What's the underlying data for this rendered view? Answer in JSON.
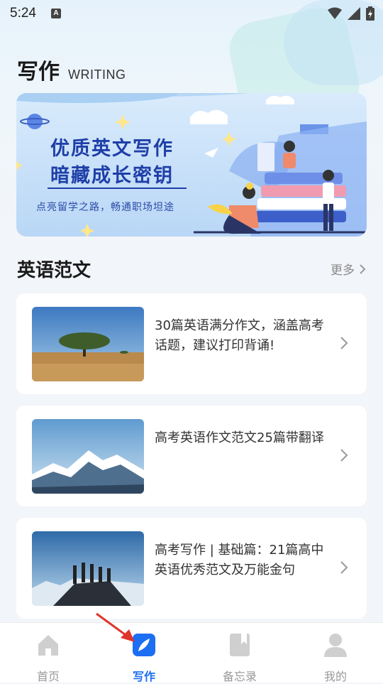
{
  "status_bar": {
    "time": "5:24",
    "notification_icon_label": "A",
    "icons": [
      "wifi-icon",
      "signal-icon",
      "battery-icon"
    ]
  },
  "header": {
    "title": "写作",
    "subtitle": "WRITING"
  },
  "banner": {
    "line1": "优质英文写作",
    "line2": "暗藏成长密钥",
    "tagline": "点亮留学之路，畅通职场坦途"
  },
  "section": {
    "title": "英语范文",
    "more_label": "更多"
  },
  "articles": [
    {
      "title": "30篇英语满分作文，涵盖高考话题，建议打印背诵!",
      "thumb": "savanna-tree-photo"
    },
    {
      "title": "高考英语作文范文25篇带翻译",
      "thumb": "snowy-mountain-photo"
    },
    {
      "title": "高考写作 | 基础篇：21篇高中英语优秀范文及万能金句",
      "thumb": "summit-hikers-photo"
    }
  ],
  "bottom_nav": [
    {
      "label": "首页",
      "icon": "home-icon",
      "active": false
    },
    {
      "label": "写作",
      "icon": "pen-icon",
      "active": true
    },
    {
      "label": "备忘录",
      "icon": "notebook-icon",
      "active": false
    },
    {
      "label": "我的",
      "icon": "user-icon",
      "active": false
    }
  ],
  "colors": {
    "accent": "#1c6ef2",
    "banner_text": "#1f3fa8",
    "pointer": "#e0352b"
  }
}
